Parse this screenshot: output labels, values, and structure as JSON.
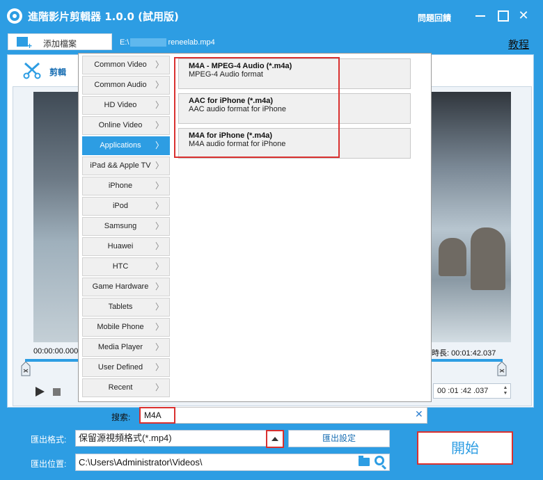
{
  "window": {
    "title": "進階影片剪輯器 1.0.0 (試用版)",
    "feedback": "問題回饋",
    "close_glyph": "✕"
  },
  "toolbar": {
    "add_file": "添加檔案",
    "filepath_prefix": "E:\\",
    "filepath_suffix": "reneelab.mp4",
    "tutorial": "教程"
  },
  "edit_tab": {
    "label": "剪輯"
  },
  "player": {
    "time_current": "00:00:00.000",
    "time_total": "時長: 00:01:42.037",
    "spinner_value": "00 :01 :42 .037",
    "spin_up": "▲",
    "spin_down": "▼"
  },
  "categories": [
    {
      "label": "Common Video",
      "active": false
    },
    {
      "label": "Common Audio",
      "active": false
    },
    {
      "label": "HD Video",
      "active": false
    },
    {
      "label": "Online Video",
      "active": false
    },
    {
      "label": "Applications",
      "active": true
    },
    {
      "label": "iPad && Apple TV",
      "active": false
    },
    {
      "label": "iPhone",
      "active": false
    },
    {
      "label": "iPod",
      "active": false
    },
    {
      "label": "Samsung",
      "active": false
    },
    {
      "label": "Huawei",
      "active": false
    },
    {
      "label": "HTC",
      "active": false
    },
    {
      "label": "Game Hardware",
      "active": false
    },
    {
      "label": "Tablets",
      "active": false
    },
    {
      "label": "Mobile Phone",
      "active": false
    },
    {
      "label": "Media Player",
      "active": false
    },
    {
      "label": "User Defined",
      "active": false
    },
    {
      "label": "Recent",
      "active": false
    }
  ],
  "chevron_glyph": "〉",
  "formats": [
    {
      "name": "M4A - MPEG-4 Audio (*.m4a)",
      "desc": "MPEG-4 Audio format"
    },
    {
      "name": "AAC for iPhone (*.m4a)",
      "desc": "AAC audio format for iPhone"
    },
    {
      "name": "M4A for iPhone (*.m4a)",
      "desc": "M4A audio format for iPhone"
    }
  ],
  "search": {
    "label": "搜索:",
    "value": "M4A",
    "clear_glyph": "✕"
  },
  "output": {
    "format_label": "匯出格式:",
    "format_value": "保留源視頻格式(*.mp4)",
    "settings_button": "匯出設定",
    "location_label": "匯出位置:",
    "location_value": "C:\\Users\\Administrator\\Videos\\",
    "start_button": "開始"
  },
  "colors": {
    "accent": "#2d9de3",
    "highlight": "#d9302f"
  }
}
